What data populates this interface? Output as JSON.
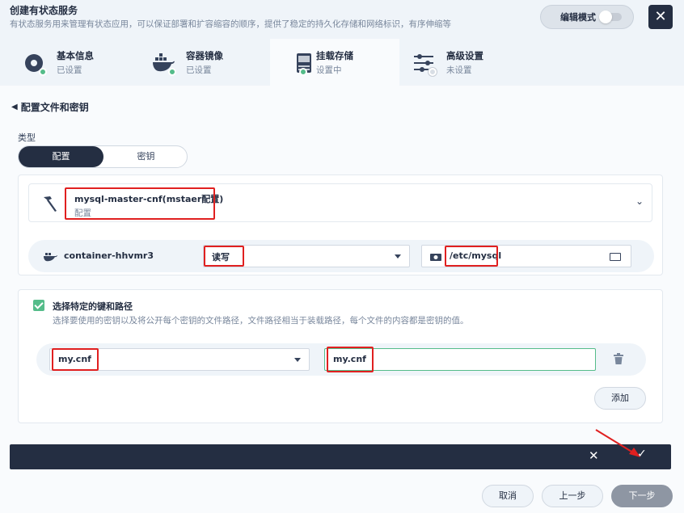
{
  "header": {
    "title": "创建有状态服务",
    "subtitle": "有状态服务用来管理有状态应用，可以保证部署和扩容缩容的顺序，提供了稳定的持久化存储和网络标识，有序伸缩等",
    "edit_mode_label": "编辑模式",
    "close_icon": "close-icon"
  },
  "steps": [
    {
      "name": "基本信息",
      "state": "已设置",
      "icon": "disc-icon",
      "status_color": "#55bc8a"
    },
    {
      "name": "容器镜像",
      "state": "已设置",
      "icon": "docker-whale-icon",
      "status_color": "#55bc8a"
    },
    {
      "name": "挂载存储",
      "state": "设置中",
      "icon": "storage-icon",
      "status_color": "#55bc8a"
    },
    {
      "name": "高级设置",
      "state": "未设置",
      "icon": "sliders-icon",
      "status_color": "#d8dee5"
    }
  ],
  "section": {
    "back_title": "配置文件和密钥"
  },
  "type_field": {
    "label": "类型",
    "options": [
      "配置",
      "密钥"
    ],
    "selected": "配置"
  },
  "resource": {
    "name": "mysql-master-cnf(mstaer配置)",
    "type": "配置"
  },
  "mount": {
    "container": "container-hhvmr3",
    "mode": "读写",
    "path": "/etc/mysql"
  },
  "keys": {
    "checked": true,
    "title": "选择特定的键和路径",
    "description": "选择要使用的密钥以及将公开每个密钥的文件路径，文件路径相当于装载路径，每个文件的内容都是密钥的值。",
    "key": "my.cnf",
    "path": "my.cnf",
    "add_label": "添加"
  },
  "footer": {
    "cancel": "取消",
    "prev": "上一步",
    "next": "下一步"
  },
  "colors": {
    "accent_green": "#55bc8a",
    "dark": "#242e42",
    "highlight_red": "#e02020"
  }
}
